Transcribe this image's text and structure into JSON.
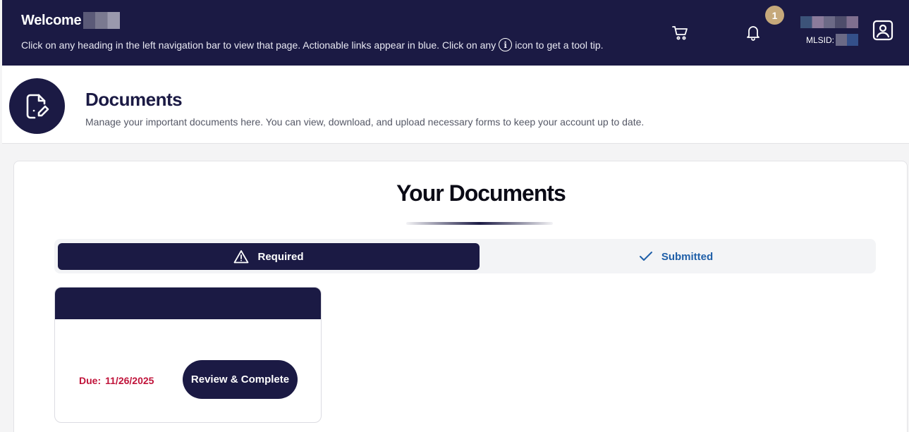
{
  "topbar": {
    "welcome_label": "Welcome",
    "instructions_before": "Click on any heading in the left navigation bar to view that page. Actionable links appear in blue. Click on any",
    "info_glyph": "i",
    "instructions_after": "icon to get a tool tip.",
    "notification_count": "1",
    "mlsid_label": "MLSID:",
    "icons": [
      "cart-icon",
      "bell-icon",
      "profile-icon",
      "info-icon"
    ]
  },
  "page_header": {
    "title": "Documents",
    "subtitle": "Manage your important documents here. You can view, download, and upload necessary forms to keep your account up to date.",
    "icon": "document-edit-icon"
  },
  "documents": {
    "title": "Your Documents",
    "tabs": [
      {
        "label": "Required",
        "icon": "warning-icon",
        "active": true
      },
      {
        "label": "Submitted",
        "icon": "check-icon",
        "active": false
      }
    ],
    "cards": [
      {
        "due_label": "Due:",
        "due_date": "11/26/2025",
        "action_label": "Review & Complete"
      }
    ]
  },
  "colors": {
    "navy": "#1b1a44",
    "gold_badge": "#c6a97b",
    "due_red": "#c0133a",
    "link_blue": "#1f5fa8"
  }
}
